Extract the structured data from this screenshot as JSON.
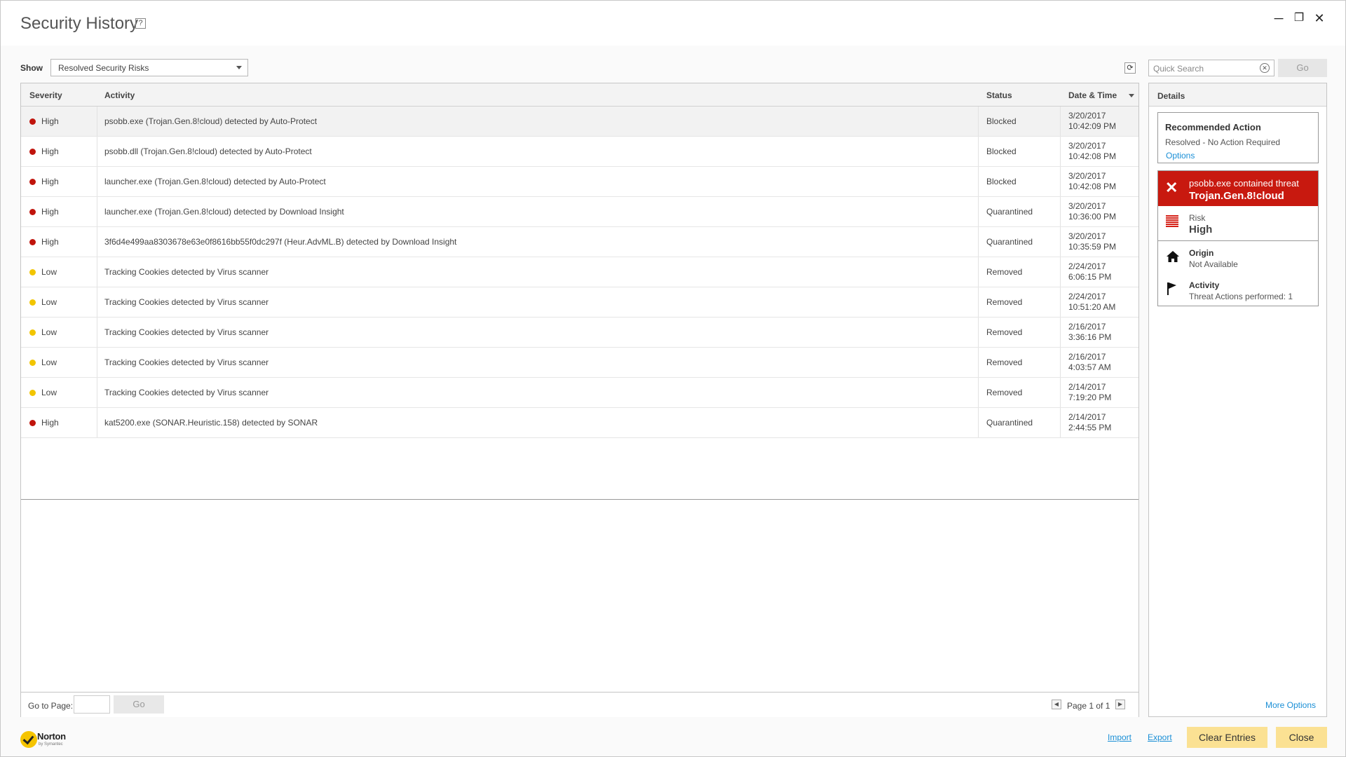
{
  "window": {
    "title": "Security History",
    "help_glyph": "?",
    "minimize_glyph": "─",
    "restore_glyph": "❐",
    "close_glyph": "✕"
  },
  "filter": {
    "show_label": "Show",
    "show_value": "Resolved Security Risks"
  },
  "search": {
    "placeholder": "Quick Search",
    "go_label": "Go",
    "clear_glyph": "✕"
  },
  "table": {
    "headers": {
      "severity": "Severity",
      "activity": "Activity",
      "status": "Status",
      "datetime": "Date & Time"
    },
    "rows": [
      {
        "severity": "High",
        "activity": "psobb.exe (Trojan.Gen.8!cloud) detected by Auto-Protect",
        "status": "Blocked",
        "date": "3/20/2017",
        "time": "10:42:09 PM"
      },
      {
        "severity": "High",
        "activity": "psobb.dll (Trojan.Gen.8!cloud) detected by Auto-Protect",
        "status": "Blocked",
        "date": "3/20/2017",
        "time": "10:42:08 PM"
      },
      {
        "severity": "High",
        "activity": "launcher.exe (Trojan.Gen.8!cloud) detected by Auto-Protect",
        "status": "Blocked",
        "date": "3/20/2017",
        "time": "10:42:08 PM"
      },
      {
        "severity": "High",
        "activity": "launcher.exe (Trojan.Gen.8!cloud) detected by Download Insight",
        "status": "Quarantined",
        "date": "3/20/2017",
        "time": "10:36:00 PM"
      },
      {
        "severity": "High",
        "activity": "3f6d4e499aa8303678e63e0f8616bb55f0dc297f (Heur.AdvML.B) detected by Download Insight",
        "status": "Quarantined",
        "date": "3/20/2017",
        "time": "10:35:59 PM"
      },
      {
        "severity": "Low",
        "activity": "Tracking Cookies detected by Virus scanner",
        "status": "Removed",
        "date": "2/24/2017",
        "time": "6:06:15 PM"
      },
      {
        "severity": "Low",
        "activity": "Tracking Cookies detected by Virus scanner",
        "status": "Removed",
        "date": "2/24/2017",
        "time": "10:51:20 AM"
      },
      {
        "severity": "Low",
        "activity": "Tracking Cookies detected by Virus scanner",
        "status": "Removed",
        "date": "2/16/2017",
        "time": "3:36:16 PM"
      },
      {
        "severity": "Low",
        "activity": "Tracking Cookies detected by Virus scanner",
        "status": "Removed",
        "date": "2/16/2017",
        "time": "4:03:57 AM"
      },
      {
        "severity": "Low",
        "activity": "Tracking Cookies detected by Virus scanner",
        "status": "Removed",
        "date": "2/14/2017",
        "time": "7:19:20 PM"
      },
      {
        "severity": "High",
        "activity": "kat5200.exe (SONAR.Heuristic.158) detected by SONAR",
        "status": "Quarantined",
        "date": "2/14/2017",
        "time": "2:44:55 PM"
      }
    ]
  },
  "pager": {
    "goto_label": "Go to Page:",
    "go_label": "Go",
    "page_info": "Page 1 of 1",
    "prev_glyph": "◀",
    "next_glyph": "▶"
  },
  "details": {
    "header": "Details",
    "recommended_title": "Recommended Action",
    "recommended_text": "Resolved - No Action Required",
    "options_link": "Options",
    "threat_line1": "psobb.exe contained threat",
    "threat_line2": "Trojan.Gen.8!cloud",
    "risk_label": "Risk",
    "risk_value": "High",
    "origin_label": "Origin",
    "origin_value": "Not Available",
    "activity_label": "Activity",
    "activity_value": "Threat Actions performed: 1",
    "more_options": "More Options"
  },
  "footer": {
    "brand_name": "Norton",
    "brand_sub": "by Symantec",
    "import": "Import",
    "export": "Export",
    "clear_entries": "Clear Entries",
    "close": "Close"
  },
  "colors": {
    "high": "#c0140c",
    "low": "#f2c500",
    "threat_banner": "#c8190f",
    "button_yellow": "#fbe193",
    "link": "#1a8fd6"
  },
  "icons": {
    "help": "help-icon",
    "refresh": "refresh-icon",
    "risk": "risk-bars-icon",
    "origin": "home-icon",
    "activity": "flag-icon",
    "threat": "close-x-icon"
  }
}
